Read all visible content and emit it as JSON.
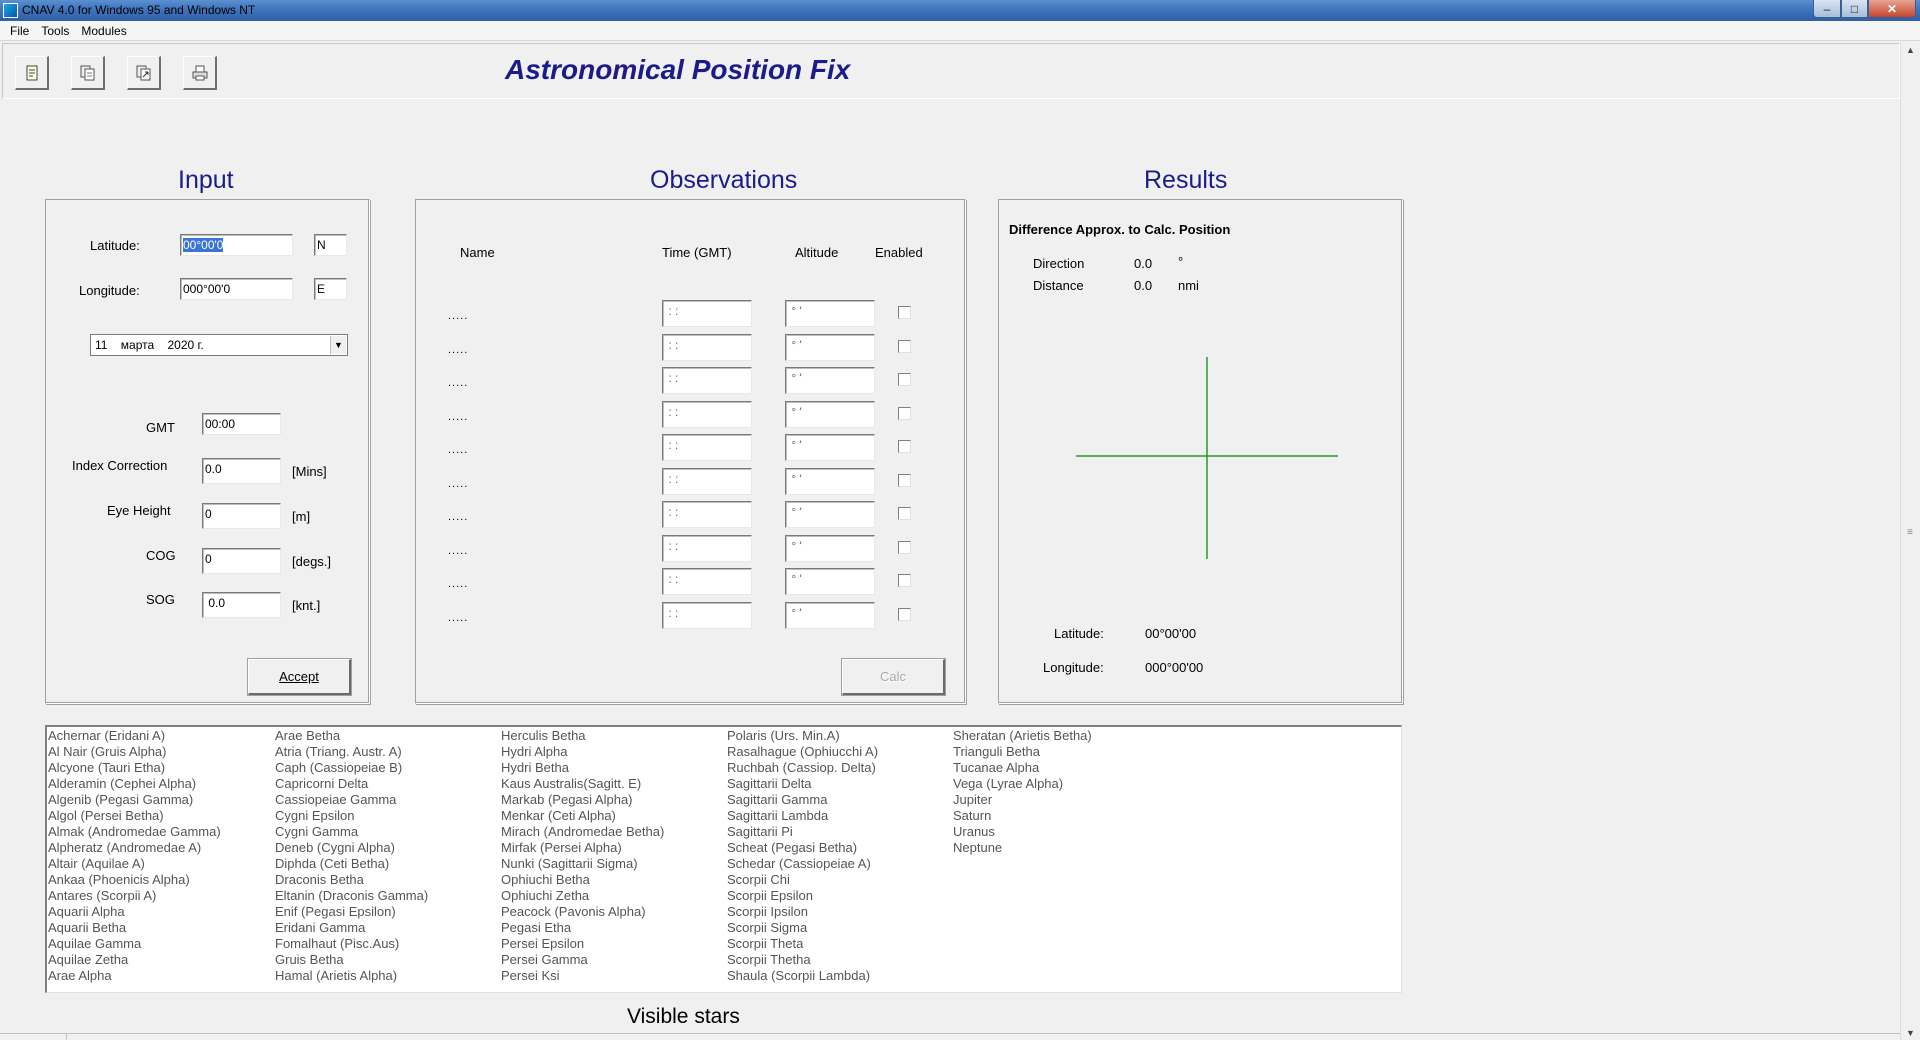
{
  "window": {
    "title": "CNAV 4.0 for Windows 95 and Windows NT",
    "buttons": {
      "minimize": "–",
      "maximize": "□",
      "close": "✕"
    }
  },
  "menu": [
    "File",
    "Tools",
    "Modules"
  ],
  "toolbar": {
    "icons": [
      "new-doc-icon",
      "copy-doc-icon",
      "export-doc-icon",
      "print-icon"
    ]
  },
  "heading": "Astronomical Position Fix",
  "input": {
    "title": "Input",
    "latitude_label": "Latitude:",
    "latitude_value": "00°00'0",
    "latitude_hemi": "N",
    "longitude_label": "Longitude:",
    "longitude_value": "000°00'0",
    "longitude_hemi": "E",
    "date_value": "11    марта    2020 г.",
    "gmt_label": "GMT",
    "gmt_value": "00:00",
    "index_label": "Index Correction",
    "index_value": "0.0",
    "index_unit": "[Mins]",
    "eye_label": "Eye Height",
    "eye_value": "0",
    "eye_unit": "[m]",
    "cog_label": "COG",
    "cog_value": "0",
    "cog_unit": "[degs.]",
    "sog_label": "SOG",
    "sog_value": " 0.0",
    "sog_unit": "[knt.]",
    "accept_label": "Accept"
  },
  "observations": {
    "title": "Observations",
    "headers": {
      "name": "Name",
      "time": "Time (GMT)",
      "altitude": "Altitude",
      "enabled": "Enabled"
    },
    "rows": [
      {
        "name": ".....",
        "time": " : :",
        "alt": " ° '"
      },
      {
        "name": ".....",
        "time": " : :",
        "alt": " ° '"
      },
      {
        "name": ".....",
        "time": " : :",
        "alt": " ° '"
      },
      {
        "name": ".....",
        "time": " : :",
        "alt": " ° '"
      },
      {
        "name": ".....",
        "time": " : :",
        "alt": " ° '"
      },
      {
        "name": ".....",
        "time": " : :",
        "alt": " ° '"
      },
      {
        "name": ".....",
        "time": " : :",
        "alt": " ° '"
      },
      {
        "name": ".....",
        "time": " : :",
        "alt": " ° '"
      },
      {
        "name": ".....",
        "time": " : :",
        "alt": " ° '"
      },
      {
        "name": ".....",
        "time": " : :",
        "alt": " ° '"
      }
    ],
    "calc_label": "Calc"
  },
  "results": {
    "title": "Results",
    "diff_heading": "Difference  Approx. to Calc. Position",
    "direction_label": "Direction",
    "direction_value": "0.0",
    "direction_unit": "°",
    "distance_label": "Distance",
    "distance_value": "0.0",
    "distance_unit": "nmi",
    "latitude_label": "Latitude:",
    "latitude_value": "00°00'00",
    "longitude_label": "Longitude:",
    "longitude_value": "000°00'00",
    "crosshair_color": "#2a9a2a"
  },
  "stars": {
    "caption": "Visible stars",
    "columns": [
      [
        "Achernar (Eridani A)",
        "Al Nair (Gruis Alpha)",
        "Alcyone (Tauri Etha)",
        "Alderamin (Cephei Alpha)",
        "Algenib (Pegasi Gamma)",
        "Algol (Persei Betha)",
        "Almak (Andromedae Gamma)",
        "Alpheratz (Andromedae A)",
        "Altair (Aquilae A)",
        "Ankaa (Phoenicis Alpha)",
        "Antares (Scorpii A)",
        "Aquarii Alpha",
        "Aquarii Betha",
        "Aquilae Gamma",
        "Aquilae Zetha",
        "Arae Alpha"
      ],
      [
        "Arae Betha",
        "Atria (Triang. Austr. A)",
        "Caph (Cassiopeiae B)",
        "Capricorni Delta",
        "Cassiopeiae Gamma",
        "Cygni Epsilon",
        "Cygni Gamma",
        "Deneb (Cygni Alpha)",
        "Diphda (Ceti Betha)",
        "Draconis Betha",
        "Eltanin (Draconis Gamma)",
        "Enif (Pegasi Epsilon)",
        "Eridani Gamma",
        "Fomalhaut (Pisc.Aus)",
        "Gruis Betha",
        "Hamal (Arietis Alpha)"
      ],
      [
        "Herculis Betha",
        "Hydri Alpha",
        "Hydri Betha",
        "Kaus Australis(Sagitt. E)",
        "Markab (Pegasi Alpha)",
        "Menkar (Ceti Alpha)",
        "Mirach (Andromedae Betha)",
        "Mirfak (Persei Alpha)",
        "Nunki (Sagittarii Sigma)",
        "Ophiuchi Betha",
        "Ophiuchi Zetha",
        "Peacock (Pavonis Alpha)",
        "Pegasi Etha",
        "Persei Epsilon",
        "Persei Gamma",
        "Persei Ksi"
      ],
      [
        "Polaris (Urs. Min.A)",
        "Rasalhague (Ophiucchi A)",
        "Ruchbah (Cassiop. Delta)",
        "Sagittarii Delta",
        "Sagittarii Gamma",
        "Sagittarii Lambda",
        "Sagittarii Pi",
        "Scheat (Pegasi Betha)",
        "Schedar (Cassiopeiae A)",
        "Scorpii Chi",
        "Scorpii Epsilon",
        "Scorpii Ipsilon",
        "Scorpii Sigma",
        "Scorpii Theta",
        "Scorpii Thetha",
        "Shaula (Scorpii Lambda)"
      ],
      [
        "Sheratan (Arietis Betha)",
        "Trianguli Betha",
        "Tucanae Alpha",
        "Vega (Lyrae Alpha)",
        "Jupiter",
        "Saturn",
        "Uranus",
        "Neptune"
      ]
    ]
  }
}
